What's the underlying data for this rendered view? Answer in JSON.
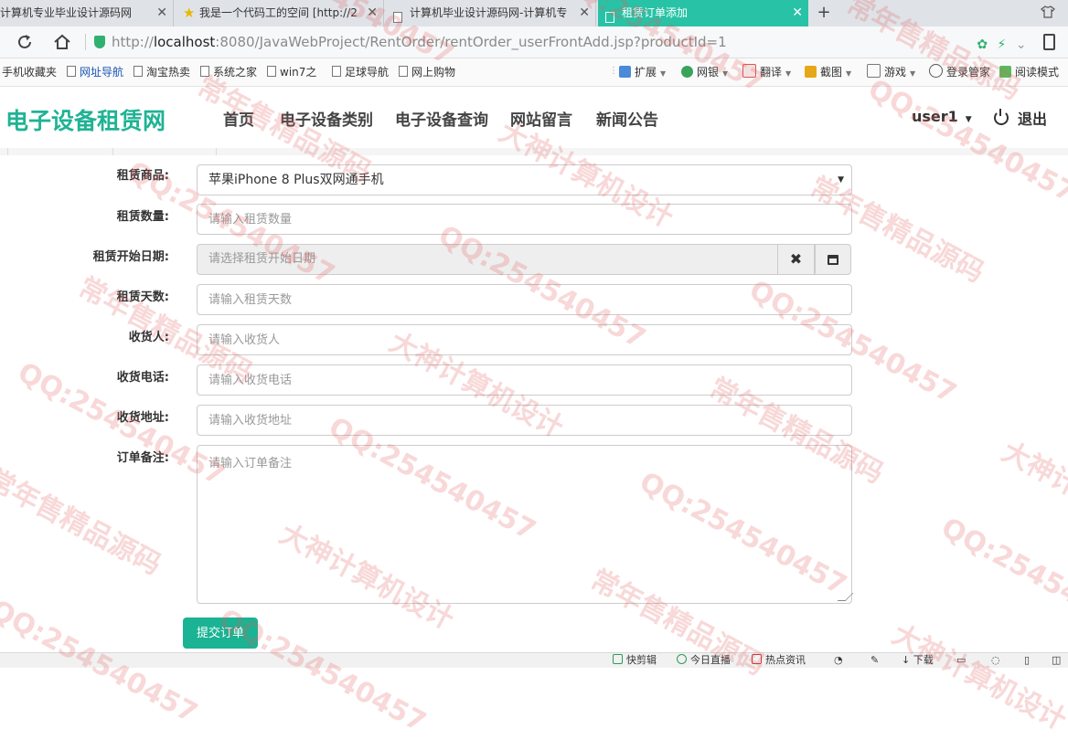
{
  "browser": {
    "tabs": [
      {
        "label": "计算机专业毕业设计源码网",
        "active": false
      },
      {
        "label": "我是一个代码工的空间 [http://2",
        "active": false
      },
      {
        "label": "计算机毕业设计源码网-计算机专",
        "active": false
      },
      {
        "label": "租赁订单添加",
        "active": true
      }
    ],
    "new_tab_symbol": "+",
    "close_symbol": "✕",
    "url_prefix": "http://",
    "url_host": "localhost",
    "url_rest": ":8080/JavaWebProject/RentOrder/rentOrder_userFrontAdd.jsp?productId=1",
    "bookmarks": [
      "手机收藏夹",
      "网址导航",
      "淘宝热卖",
      "系统之家",
      "win7之",
      "足球导航",
      "网上购物"
    ],
    "tools": [
      "扩展",
      "网银",
      "翻译",
      "截图",
      "游戏",
      "登录管家",
      "阅读模式"
    ]
  },
  "site": {
    "brand": "电子设备租赁网",
    "nav": [
      "首页",
      "电子设备类别",
      "电子设备查询",
      "网站留言",
      "新闻公告"
    ],
    "user": "user1",
    "logout": "退出"
  },
  "form": {
    "product_label": "租赁商品:",
    "product_value": "苹果iPhone 8 Plus双网通手机",
    "quantity_label": "租赁数量:",
    "quantity_placeholder": "请输入租赁数量",
    "start_label": "租赁开始日期:",
    "start_placeholder": "请选择租赁开始日期",
    "days_label": "租赁天数:",
    "days_placeholder": "请输入租赁天数",
    "receiver_label": "收货人:",
    "receiver_placeholder": "请输入收货人",
    "phone_label": "收货电话:",
    "phone_placeholder": "请输入收货电话",
    "address_label": "收货地址:",
    "address_placeholder": "请输入收货地址",
    "memo_label": "订单备注:",
    "memo_placeholder": "请输入订单备注",
    "submit": "提交订单"
  },
  "statusbar": [
    "快剪辑",
    "今日直播",
    "热点资讯",
    "下载"
  ],
  "watermarks": [
    "QQ:254540457",
    "大神计算机设计",
    "常年售精品源码"
  ],
  "colors": {
    "accent": "#1ab394",
    "active_tab": "#28c3a6",
    "watermark": "#e15a5a"
  }
}
